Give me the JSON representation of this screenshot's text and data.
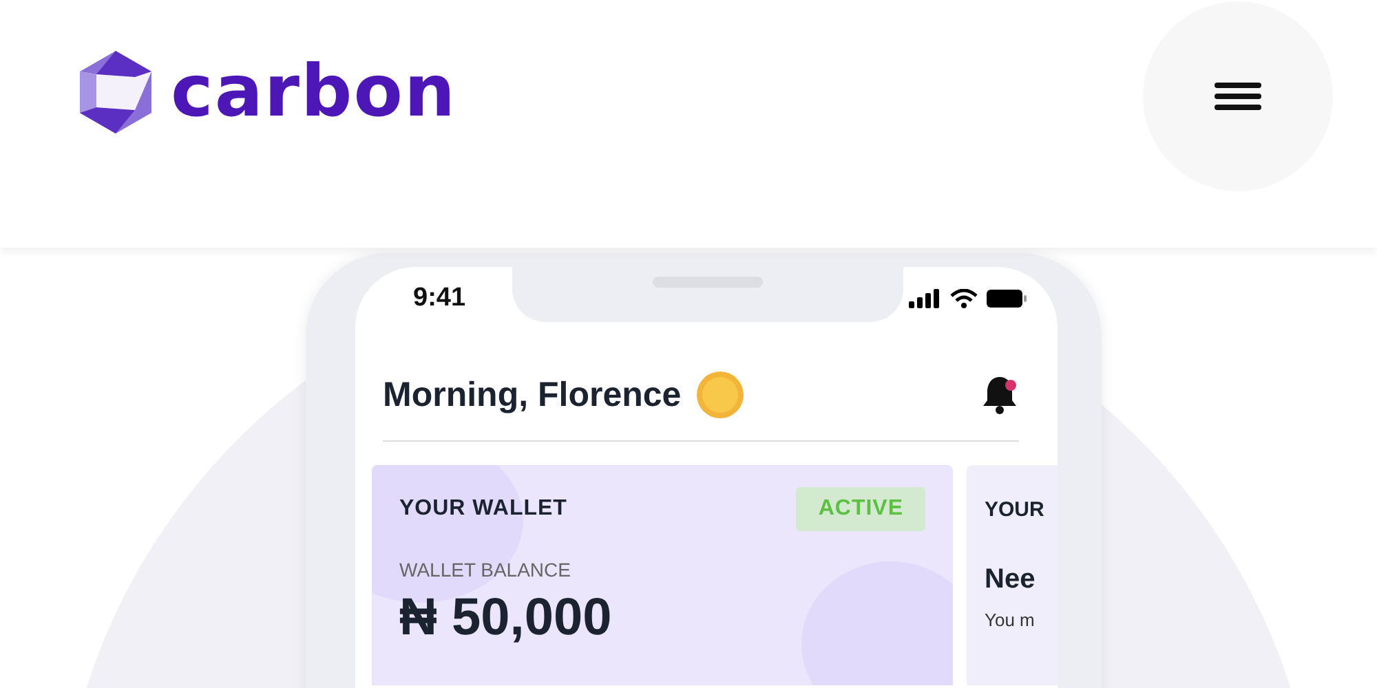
{
  "header": {
    "logo_text": "carbon"
  },
  "phone": {
    "status_bar": {
      "time": "9:41"
    },
    "greeting": "Morning, Florence",
    "notifications": {
      "unread": true
    },
    "cards": [
      {
        "title": "YOUR WALLET",
        "badge": "ACTIVE",
        "balance_label": "WALLET BALANCE",
        "balance": "₦ 50,000"
      },
      {
        "title": "YOUR",
        "heading": "Nee",
        "text": "You m"
      }
    ]
  }
}
